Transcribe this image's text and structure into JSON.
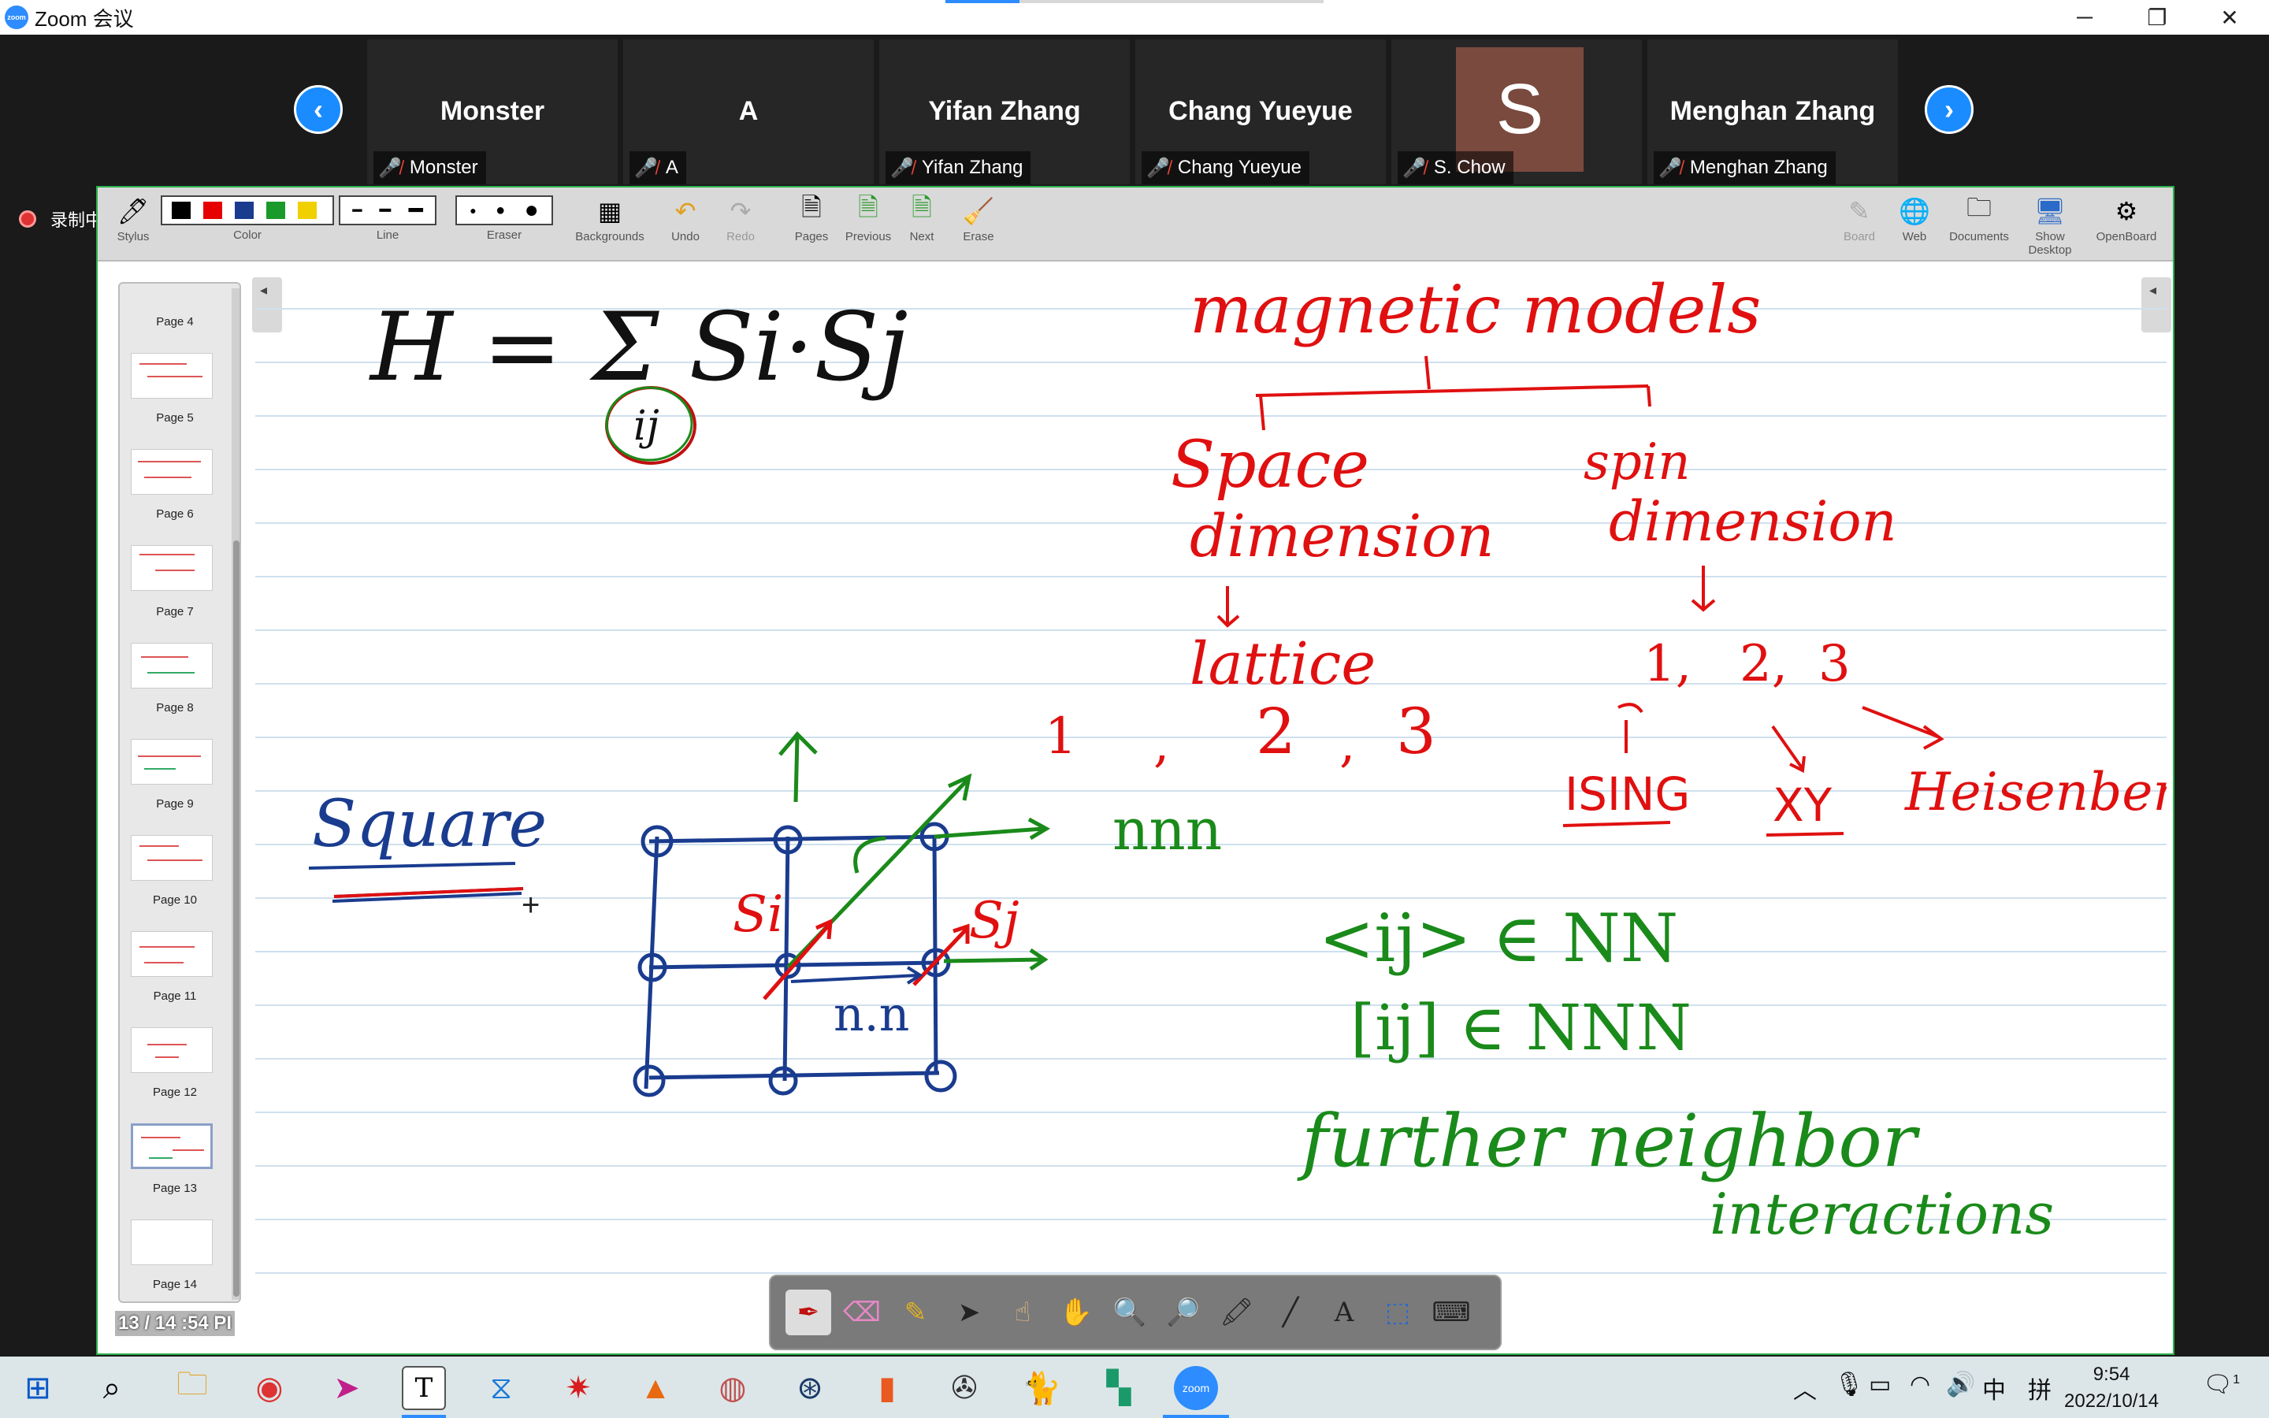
{
  "window": {
    "title": "Zoom 会议",
    "logo_text": "zoom"
  },
  "gallery": {
    "participants": [
      {
        "tile_name": "Monster",
        "label": "Monster"
      },
      {
        "tile_name": "A",
        "label": "A"
      },
      {
        "tile_name": "Yifan Zhang",
        "label": "Yifan Zhang"
      },
      {
        "tile_name": "Chang Yueyue",
        "label": "Chang Yueyue"
      },
      {
        "tile_name": "",
        "avatar_letter": "S",
        "label": "S. Chow"
      },
      {
        "tile_name": "Menghan Zhang",
        "label": "Menghan Zhang"
      }
    ]
  },
  "recording": {
    "label": "录制中"
  },
  "toolbar": {
    "stylus": "Stylus",
    "color": "Color",
    "line": "Line",
    "eraser": "Eraser",
    "backgrounds": "Backgrounds",
    "undo": "Undo",
    "redo": "Redo",
    "pages": "Pages",
    "previous": "Previous",
    "next": "Next",
    "erase": "Erase",
    "board": "Board",
    "web": "Web",
    "documents": "Documents",
    "show_desktop": "Show Desktop",
    "openboard": "OpenBoard",
    "colors": [
      "#000000",
      "#e60000",
      "#1a3c8f",
      "#1a9a2a",
      "#f0d000"
    ]
  },
  "pages": {
    "labels": [
      "Page 4",
      "Page 5",
      "Page 6",
      "Page 7",
      "Page 8",
      "Page 9",
      "Page 10",
      "Page 11",
      "Page 12",
      "Page 13",
      "Page 14"
    ],
    "current_info": "13 / 14 :54 PI"
  },
  "board": {
    "hamiltonian": "H = Σ Si·Sj",
    "sum_index": "ij",
    "heading": "magnetic models",
    "branch_left": [
      "Space",
      "dimension"
    ],
    "branch_right": [
      "spin",
      "dimension"
    ],
    "lattice": "lattice",
    "lattice_dims": [
      "1",
      ",",
      "2",
      ",",
      "3"
    ],
    "spin_dims": [
      "1,",
      "2,",
      "3"
    ],
    "models": [
      "ISING",
      "XY",
      "Heisenberg"
    ],
    "square": "Square",
    "si": "Si",
    "sj": "Sj",
    "nn": "n.n",
    "nnn": "nnn",
    "nn_set": "<ij> ∈ NN",
    "nnn_set": "[ij] ∈ NNN",
    "further": [
      "further neighbor",
      "interactions"
    ]
  },
  "taskbar": {
    "time": "9:54",
    "date": "2022/10/14",
    "ime1": "中",
    "ime2": "拼",
    "notif_count": "1"
  }
}
